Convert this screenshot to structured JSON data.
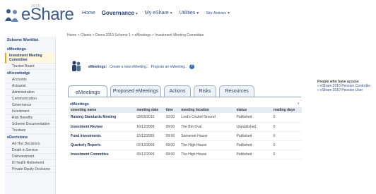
{
  "header": {
    "logo_small": "2010",
    "logo_text": "eShare",
    "nav": [
      {
        "label": "Home",
        "style": "normal",
        "caret": false
      },
      {
        "label": "Governance",
        "style": "bold",
        "caret": true
      },
      {
        "label": "My eShare",
        "style": "normal",
        "caret": true
      },
      {
        "label": "Utilities",
        "style": "normal",
        "caret": true
      },
      {
        "label": "Site Actions",
        "style": "small",
        "caret": true
      }
    ]
  },
  "sidebar": {
    "sections": [
      {
        "title": "Scheme Worklist",
        "items": []
      },
      {
        "title": "eMeetings",
        "items": [
          {
            "label": "Investment Meeting Committee",
            "active": true
          },
          {
            "label": "Trustee Board",
            "active": false
          }
        ]
      },
      {
        "title": "eKnowledge",
        "items": [
          {
            "label": "Accounts",
            "active": false
          },
          {
            "label": "Actuarial",
            "active": false
          },
          {
            "label": "Administration",
            "active": false
          },
          {
            "label": "Communication",
            "active": false
          },
          {
            "label": "Governance",
            "active": false
          },
          {
            "label": "Investment",
            "active": false
          },
          {
            "label": "Risk Benefits",
            "active": false
          },
          {
            "label": "Scheme Documentation",
            "active": false
          },
          {
            "label": "Trustees",
            "active": false
          }
        ]
      },
      {
        "title": "eDecisions",
        "items": [
          {
            "label": "Ad Hoc Decisions",
            "active": false
          },
          {
            "label": "Death in Service",
            "active": false
          },
          {
            "label": "Disinvestment",
            "active": false
          },
          {
            "label": "Ill Health Retirement",
            "active": false
          },
          {
            "label": "Private Equity Decisions",
            "active": false
          }
        ]
      }
    ]
  },
  "breadcrumb": "Home > Clients > Demo 2010 Scheme 1 > eMeetings > Investment Meeting Committee",
  "emeetings_bar": {
    "label": "eMeetings:",
    "create_link": "Create a new eMeeting..",
    "propose_link": "Propose an eMeeting..",
    "help": "?"
  },
  "tabs": [
    {
      "label": "eMeetings",
      "active": true
    },
    {
      "label": "Proposed eMeetings",
      "active": false
    },
    {
      "label": "Actions",
      "active": false
    },
    {
      "label": "Risks",
      "active": false
    },
    {
      "label": "Resources",
      "active": false
    }
  ],
  "table": {
    "title": "eMeetings",
    "close": "x",
    "columns": [
      "emeeting name",
      "meeting date",
      "time",
      "meeting location",
      "status",
      "reading days"
    ],
    "rows": [
      [
        "Raising Standards Meeting",
        "03/03/2010",
        "10:00",
        "Lord's Cricket Ground",
        "Published",
        "0"
      ],
      [
        "Investment Review",
        "16/12/2009",
        "09:00",
        "The Brit Oval",
        "Unpublished",
        "0"
      ],
      [
        "Fund Investments",
        "15/12/2009",
        "09:00",
        "Somerset House",
        "Published",
        "0"
      ],
      [
        "Quarterly Reports",
        "07/12/2009",
        "09:00",
        "The High House",
        "Published",
        "0"
      ],
      [
        "Investment Committee",
        "05/12/2009",
        "09:00",
        "The High House",
        "Published",
        "0"
      ]
    ]
  },
  "right_info": {
    "heading": "People who have access",
    "links": [
      "eShare 2010 Pension Controller",
      "eShare 2010 Pension User"
    ],
    "bullet": "»"
  },
  "colors": {
    "brand": "#3d5a86",
    "link": "#2d4f8c",
    "accent": "#f0a020"
  }
}
